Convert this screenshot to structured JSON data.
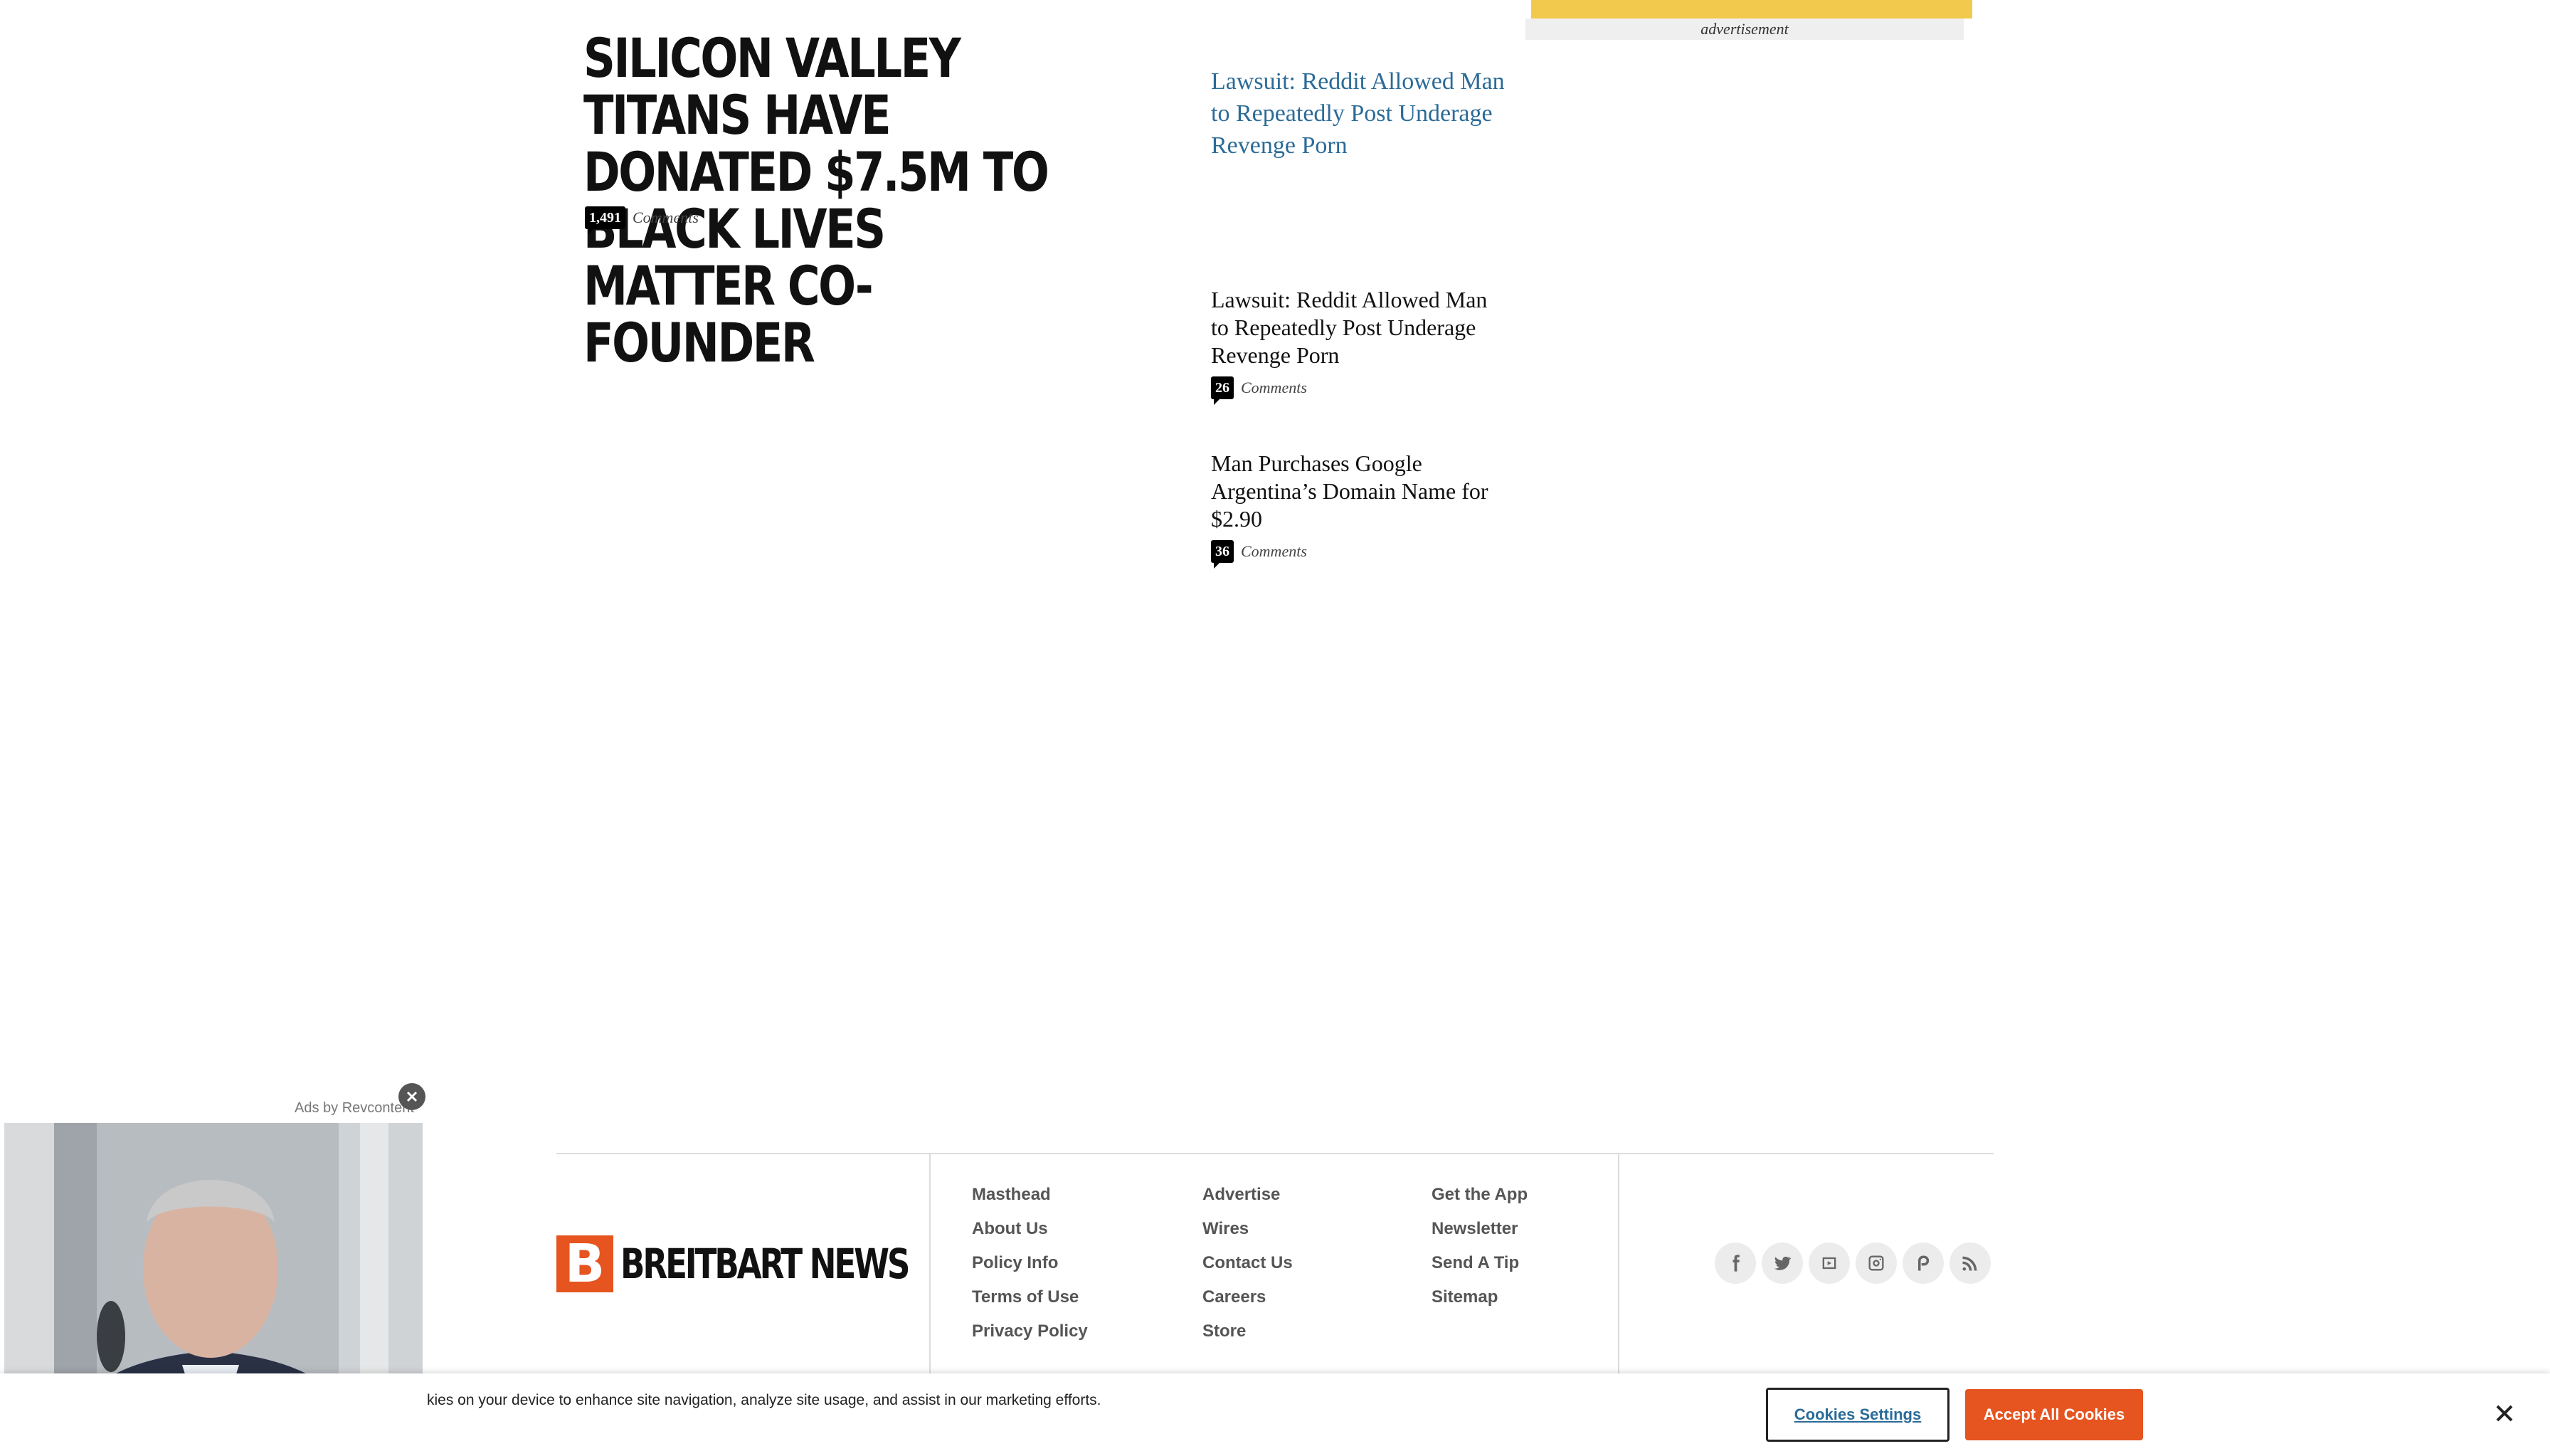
{
  "main_story": {
    "headline": "SILICON VALLEY TITANS HAVE DONATED $7.5M TO BLACK LIVES MATTER CO-FOUNDER",
    "comment_count": "1,491",
    "comment_label": "Comments"
  },
  "sidebar": {
    "featured_link": "Lawsuit: Reddit Allowed Man to Repeatedly Post Underage Revenge Porn",
    "stories": [
      {
        "title": "Lawsuit: Reddit Allowed Man to Repeatedly Post Underage Revenge Porn",
        "comment_count": "26",
        "comment_label": "Comments"
      },
      {
        "title": "Man Purchases Google Argentina’s Domain Name for $2.90",
        "comment_count": "36",
        "comment_label": "Comments"
      }
    ]
  },
  "ad": {
    "label": "advertisement"
  },
  "footer": {
    "logo_mark": "B",
    "logo_text": "BREITBART NEWS",
    "col1": [
      "Masthead",
      "About Us",
      "Policy Info",
      "Terms of Use",
      "Privacy Policy"
    ],
    "col2": [
      "Advertise",
      "Wires",
      "Contact Us",
      "Careers",
      "Store"
    ],
    "col3": [
      "Get the App",
      "Newsletter",
      "Send A Tip",
      "Sitemap"
    ],
    "social_icons": [
      "facebook-icon",
      "twitter-icon",
      "youtube-icon",
      "instagram-icon",
      "parler-icon",
      "rss-icon"
    ]
  },
  "video_ad": {
    "label": "Ads by Revcontent"
  },
  "cookie_banner": {
    "text": "kies on your device to enhance site navigation, analyze site usage, and assist in our marketing efforts.",
    "settings_label": "Cookies Settings",
    "accept_label": "Accept All Cookies"
  },
  "colors": {
    "brand": "#e65420",
    "link": "#2a6b98",
    "ad_bar": "#f2c94c"
  }
}
